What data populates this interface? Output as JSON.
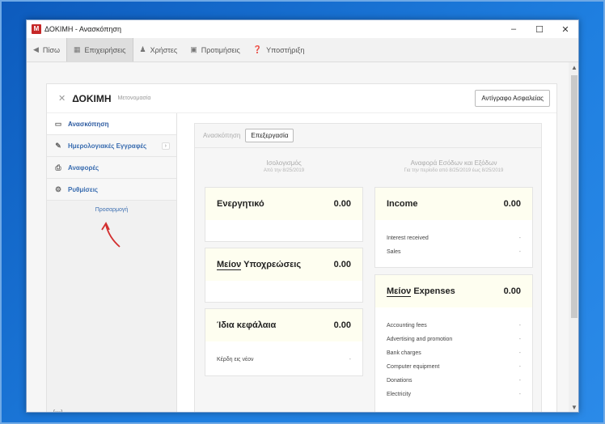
{
  "window": {
    "logo": "M",
    "title": "ΔΟΚΙΜΗ - Ανασκόπηση",
    "minimize_icon": "minimize-icon",
    "maximize_icon": "maximize-icon",
    "close_icon": "close-icon"
  },
  "toolbar": {
    "items": [
      {
        "label": "Πίσω",
        "icon": "back-icon"
      },
      {
        "label": "Επιχειρήσεις",
        "icon": "building-icon"
      },
      {
        "label": "Χρήστες",
        "icon": "users-icon"
      },
      {
        "label": "Προτιμήσεις",
        "icon": "preferences-icon"
      },
      {
        "label": "Υποστήριξη",
        "icon": "help-icon"
      }
    ]
  },
  "company": {
    "name": "ΔΟΚΙΜΗ",
    "rename_label": "Μετονομασία",
    "backup_label": "Αντίγραφο Ασφαλείας"
  },
  "nav": {
    "items": [
      {
        "label": "Ανασκόπηση",
        "icon": "monitor-icon"
      },
      {
        "label": "Ημερολογιακές Εγγραφές",
        "icon": "pencil-icon",
        "badge": "›"
      },
      {
        "label": "Αναφορές",
        "icon": "printer-icon"
      },
      {
        "label": "Ρυθμίσεις",
        "icon": "gears-icon"
      }
    ],
    "customize_label": "Προσαρμογή",
    "footer_icon": "[•••]"
  },
  "main": {
    "tab_label": "Ανασκόπηση",
    "edit_label": "Επεξεργασία",
    "balance": {
      "title": "Ισολογισμός",
      "subtitle": "Από την 8/25/2019"
    },
    "income_statement": {
      "title": "Αναφορά Εσόδων και Εξόδων",
      "subtitle": "Για την περίοδο από 8/25/2019 έως 8/25/2019"
    },
    "cards": {
      "assets": {
        "title": "Ενεργητικό",
        "value": "0.00"
      },
      "liabilities": {
        "prefix": "Μείον",
        "title": "Υποχρεώσεις",
        "value": "0.00"
      },
      "equity": {
        "title": "Ίδια κεφάλαια",
        "value": "0.00",
        "rows": [
          {
            "label": "Κέρδη εις νέον",
            "value": "-"
          }
        ]
      },
      "income": {
        "title": "Income",
        "value": "0.00",
        "rows": [
          {
            "label": "Interest received",
            "value": "-"
          },
          {
            "label": "Sales",
            "value": "-"
          }
        ]
      },
      "expenses": {
        "prefix": "Μείον",
        "title": "Expenses",
        "value": "0.00",
        "rows": [
          {
            "label": "Accounting fees",
            "value": "-"
          },
          {
            "label": "Advertising and promotion",
            "value": "-"
          },
          {
            "label": "Bank charges",
            "value": "-"
          },
          {
            "label": "Computer equipment",
            "value": "-"
          },
          {
            "label": "Donations",
            "value": "-"
          },
          {
            "label": "Electricity",
            "value": "-"
          }
        ]
      }
    }
  }
}
